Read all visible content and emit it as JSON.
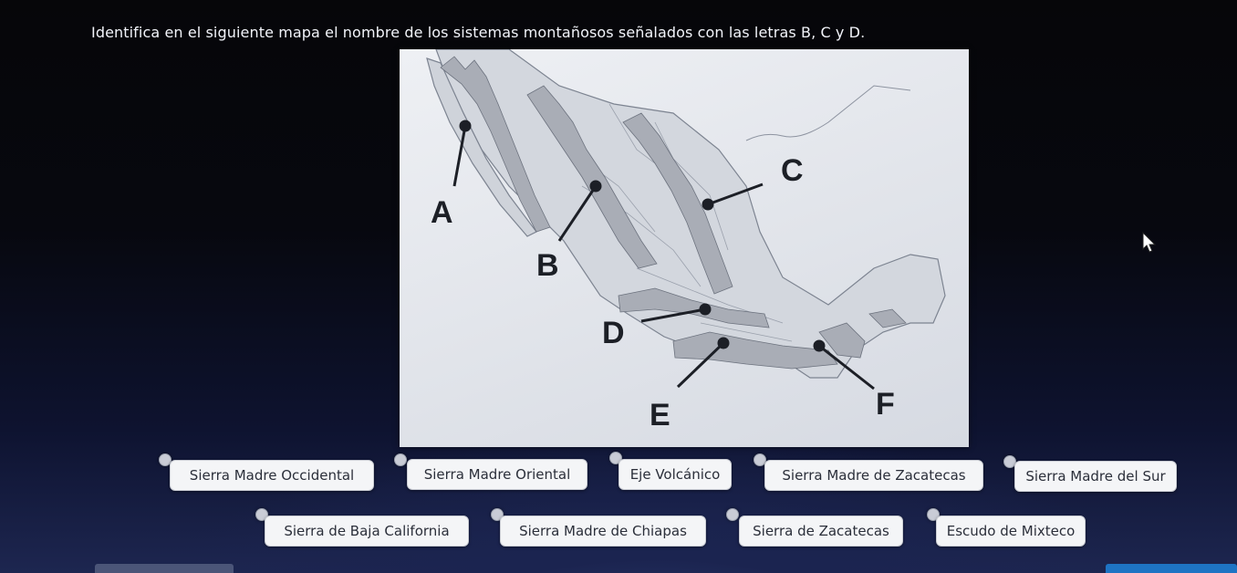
{
  "question": "Identifica en el siguiente mapa el nombre de los sistemas montañosos señalados con las letras B, C y D.",
  "map": {
    "labels": [
      "A",
      "B",
      "C",
      "D",
      "E",
      "F"
    ]
  },
  "options_row1": [
    "Sierra Madre Occidental",
    "Sierra Madre Oriental",
    "Eje Volcánico",
    "Sierra Madre de Zacatecas",
    "Sierra Madre del Sur"
  ],
  "options_row2": [
    "Sierra de Baja California",
    "Sierra Madre de Chiapas",
    "Sierra de Zacatecas",
    "Escudo de Mixteco"
  ],
  "colors": {
    "accent": "#1e74c4",
    "chip_bg": "#f4f5f7"
  }
}
